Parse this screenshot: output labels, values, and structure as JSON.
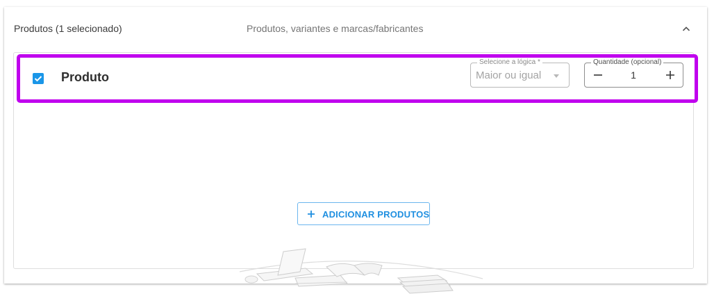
{
  "section": {
    "title": "Produtos (1 selecionado)",
    "subtitle": "Produtos, variantes e marcas/fabricantes",
    "collapse_icon": "chevron-up-icon"
  },
  "product_rule": {
    "checked": true,
    "label": "Produto",
    "logic_select": {
      "legend": "Selecione a lógica *",
      "value": "Maior ou igual"
    },
    "quantity": {
      "legend": "Quantidade (opcional)",
      "value": "1"
    }
  },
  "add_button": {
    "label": "ADICIONAR PRODUTOS",
    "icon": "plus-icon"
  },
  "empty_state": {
    "illustration": "desk-with-laptop-books-illustration"
  },
  "colors": {
    "highlight_border": "#c000ee",
    "accent": "#1a96e8",
    "button_text": "#1f8fe0"
  }
}
